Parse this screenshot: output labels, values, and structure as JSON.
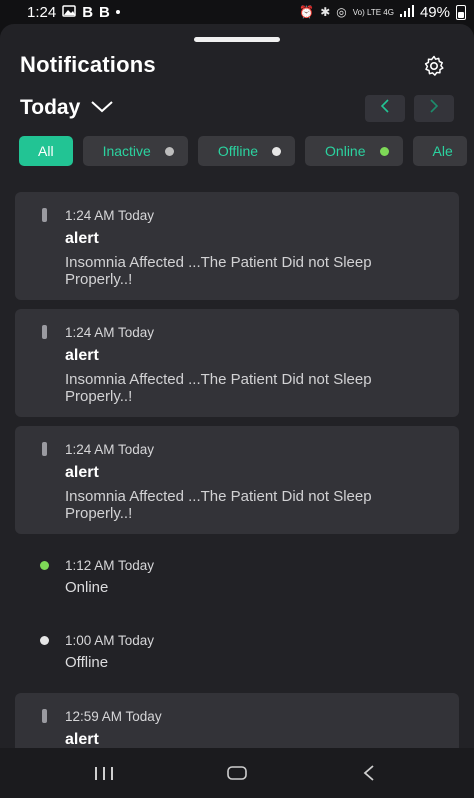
{
  "status_bar": {
    "time": "1:24",
    "app_letters": [
      "B",
      "B"
    ],
    "network_text": "Vo) LTE 4G",
    "battery": "49%"
  },
  "header": {
    "title": "Notifications",
    "day_selector": "Today"
  },
  "filters": [
    {
      "label": "All",
      "active": true
    },
    {
      "label": "Inactive",
      "dot_color": "#bdbdbd"
    },
    {
      "label": "Offline",
      "dot_color": "#e6e6e6"
    },
    {
      "label": "Online",
      "dot_color": "#7ed957"
    },
    {
      "label": "Ale"
    }
  ],
  "notifications": [
    {
      "time": "1:24 AM Today",
      "title": "alert",
      "message": "Insomnia Affected ...The Patient Did not Sleep Properly..!"
    },
    {
      "time": "1:24 AM Today",
      "title": "alert",
      "message": "Insomnia Affected ...The Patient Did not Sleep Properly..!"
    },
    {
      "time": "1:24 AM Today",
      "title": "alert",
      "message": "Insomnia Affected ...The Patient Did not Sleep Properly..!"
    },
    {
      "time": "1:12 AM Today",
      "text": "Online",
      "dot_color": "#7ed957"
    },
    {
      "time": "1:00 AM Today",
      "text": "Offline",
      "dot_color": "#e6e6e6"
    },
    {
      "time": "12:59 AM Today",
      "title": "alert"
    }
  ],
  "colors": {
    "accent": "#22c494",
    "accent_text": "#2bd3a0",
    "sheet_bg": "#222226",
    "card_bg": "#333338"
  }
}
